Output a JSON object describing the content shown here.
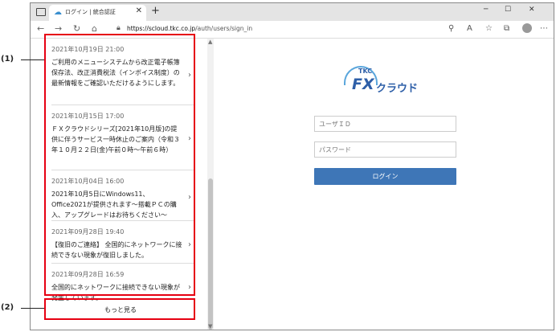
{
  "browser": {
    "tab_title": "ログイン | 統合認証",
    "url_scheme_host": "https://scloud.tkc.co.jp",
    "url_path": "/auth/users/sign_in"
  },
  "news": {
    "items": [
      {
        "date": "2021年10月19日 21:00",
        "text": "ご利用のメニューシステムから改正電子帳簿保存法、改正消費税法（インボイス制度）の最新情報をご確認いただけるようにします。"
      },
      {
        "date": "2021年10月15日 17:00",
        "text": "ＦＸクラウドシリーズ[2021年10月版]の提供に伴うサービス一時休止のご案内（令和３年１０月２２日(金)午前０時～午前６時）"
      },
      {
        "date": "2021年10月04日 16:00",
        "text": "2021年10月5日にWindows11、Office2021が提供されます～搭載ＰＣの購入、アップグレードはお待ちください～"
      },
      {
        "date": "2021年09月28日 19:40",
        "text": "【復旧のご連絡】 全国的にネットワークに接続できない現象が復旧しました。"
      },
      {
        "date": "2021年09月28日 16:59",
        "text": "全国的にネットワークに接続できない現象が発生しています。"
      }
    ],
    "more_label": "もっと見る"
  },
  "annotations": {
    "label_1": "(1)",
    "label_2": "(2)",
    "color": "#e60012"
  },
  "login": {
    "logo_tkc": "TKC",
    "logo_fx": "FX",
    "logo_cloud": "クラウド",
    "user_placeholder": "ユーザＩＤ",
    "password_placeholder": "パスワード",
    "button_label": "ログイン",
    "button_color": "#3e76b7"
  }
}
